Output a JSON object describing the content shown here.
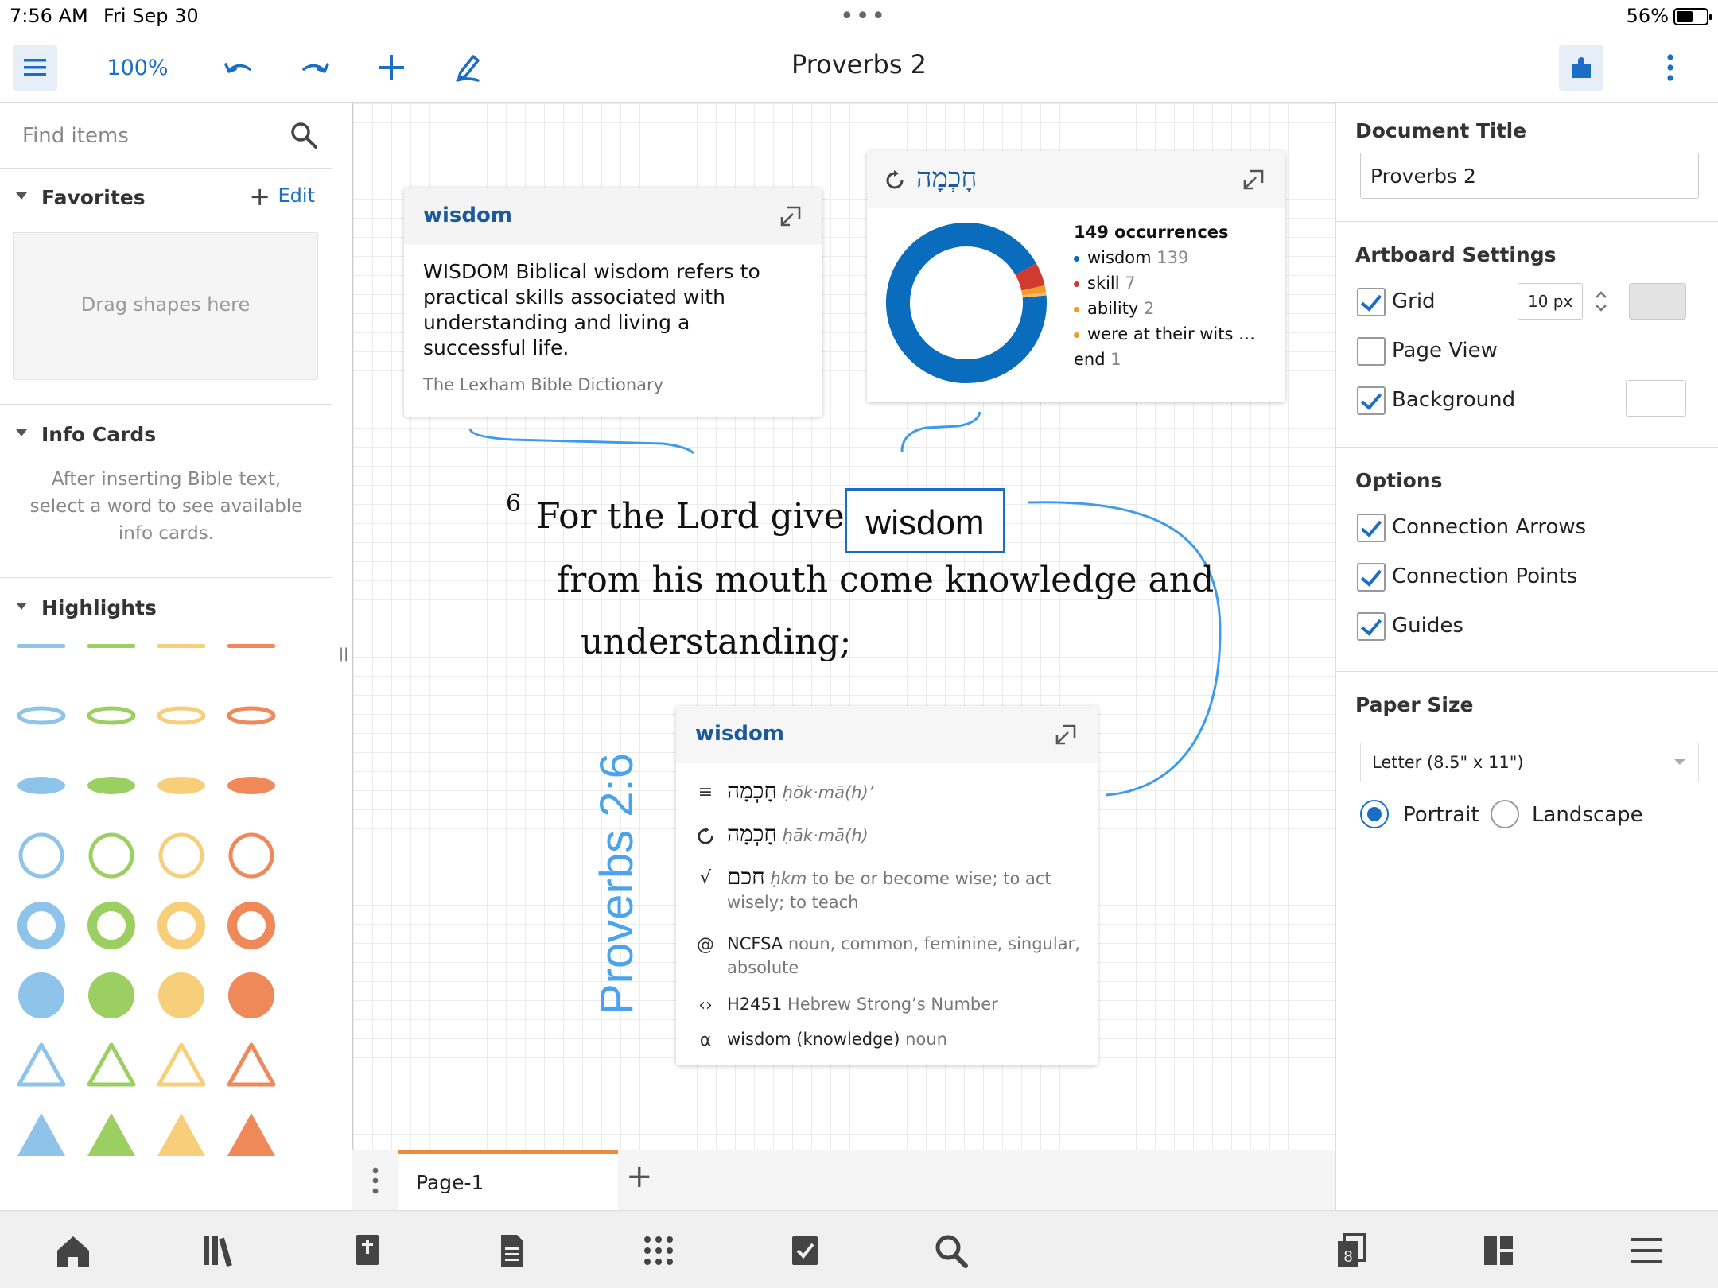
{
  "status_bar": {
    "time": "7:56 AM",
    "date": "Fri Sep 30",
    "battery": "56%",
    "battery_level": 0.56
  },
  "toolbar": {
    "zoom": "100%",
    "title": "Proverbs 2",
    "icons": [
      "menu-icon",
      "undo-icon",
      "redo-icon",
      "plus-icon",
      "pen-icon",
      "extension-icon",
      "more-vertical-icon"
    ]
  },
  "left_panel": {
    "search_placeholder": "Find items",
    "favorites": {
      "title": "Favorites",
      "edit": "Edit",
      "drag_hint": "Drag shapes here"
    },
    "info_cards": {
      "title": "Info Cards",
      "help": "After inserting Bible text, select a word to see available info cards."
    },
    "highlights": {
      "title": "Highlights",
      "colors": [
        "#8ec3ea",
        "#9ccf62",
        "#f7cf7a",
        "#f0895a"
      ]
    }
  },
  "canvas": {
    "card_dictionary": {
      "title": "wisdom",
      "body": "WISDOM Biblical wisdom refers to practical skills associated with understanding and living a successful life.",
      "source": "The Lexham Bible Dictionary"
    },
    "card_occurrences": {
      "hebrew": "חָכְמָה",
      "total": "149 occurrences",
      "items": [
        {
          "label": "wisdom",
          "count": "139",
          "value": 139,
          "color": "#0a6cbd"
        },
        {
          "label": "skill",
          "count": "7",
          "value": 7,
          "color": "#d33a2f"
        },
        {
          "label": "ability",
          "count": "2",
          "value": 2,
          "color": "#f39a2b"
        },
        {
          "label": "were at their wits …",
          "count": "",
          "value": 0,
          "color": "#f39a2b"
        },
        {
          "label": "end",
          "count": "1",
          "value": 1,
          "color": "#f7b766"
        }
      ]
    },
    "verse": {
      "number": "6",
      "line1": "For the Lord gives",
      "selected_word": "wisdom",
      "line2": "from his mouth come knowledge and",
      "line3": "understanding;"
    },
    "reference": "Proverbs 2:6",
    "card_word": {
      "title": "wisdom",
      "rows": [
        {
          "icon": "lemma-icon",
          "hebrew": "חָכְמָה",
          "translit": "ḥŏk·mā(h)’",
          "text": "",
          "gloss": ""
        },
        {
          "icon": "root-cycle-icon",
          "hebrew": "חָכְמָה",
          "translit": "ḥāk·mā(h)",
          "text": "",
          "gloss": ""
        },
        {
          "icon": "root-icon",
          "hebrew": "חכם",
          "translit": "ḥkm",
          "text": "",
          "gloss": "to be or become wise; to act wisely; to teach"
        },
        {
          "icon": "morph-at-icon",
          "hebrew": "",
          "translit": "",
          "text": "NCFSA",
          "gloss": "noun, common, feminine, singular, absolute"
        },
        {
          "icon": "code-icon",
          "hebrew": "",
          "translit": "",
          "text": "H2451",
          "gloss": "Hebrew Strong’s Number"
        },
        {
          "icon": "alpha-icon",
          "hebrew": "",
          "translit": "",
          "text": "wisdom (knowledge)",
          "gloss": "noun"
        }
      ]
    }
  },
  "page_tabs": {
    "active": "Page-1"
  },
  "right_panel": {
    "document_title_label": "Document Title",
    "document_title_value": "Proverbs 2",
    "artboard_label": "Artboard Settings",
    "grid": {
      "label": "Grid",
      "checked": true,
      "size": "10 px"
    },
    "page_view": {
      "label": "Page View",
      "checked": false
    },
    "background": {
      "label": "Background",
      "checked": true
    },
    "options_label": "Options",
    "options": [
      {
        "label": "Connection Arrows",
        "checked": true
      },
      {
        "label": "Connection Points",
        "checked": true
      },
      {
        "label": "Guides",
        "checked": true
      }
    ],
    "paper_size_label": "Paper Size",
    "paper_size": "Letter (8.5\" x 11\")",
    "orientation": {
      "portrait": "Portrait",
      "landscape": "Landscape",
      "selected": "portrait"
    }
  },
  "bottom_nav": {
    "icons": [
      "home-icon",
      "library-icon",
      "bible-icon",
      "document-icon",
      "apps-grid-icon",
      "checklist-icon",
      "search-icon",
      "panels-icon",
      "layout-icon",
      "menu-icon"
    ],
    "panels_badge": "8"
  },
  "colors": {
    "accent": "#1a6ec4",
    "link_line": "#3d9be9",
    "tab_accent": "#f0893a"
  }
}
